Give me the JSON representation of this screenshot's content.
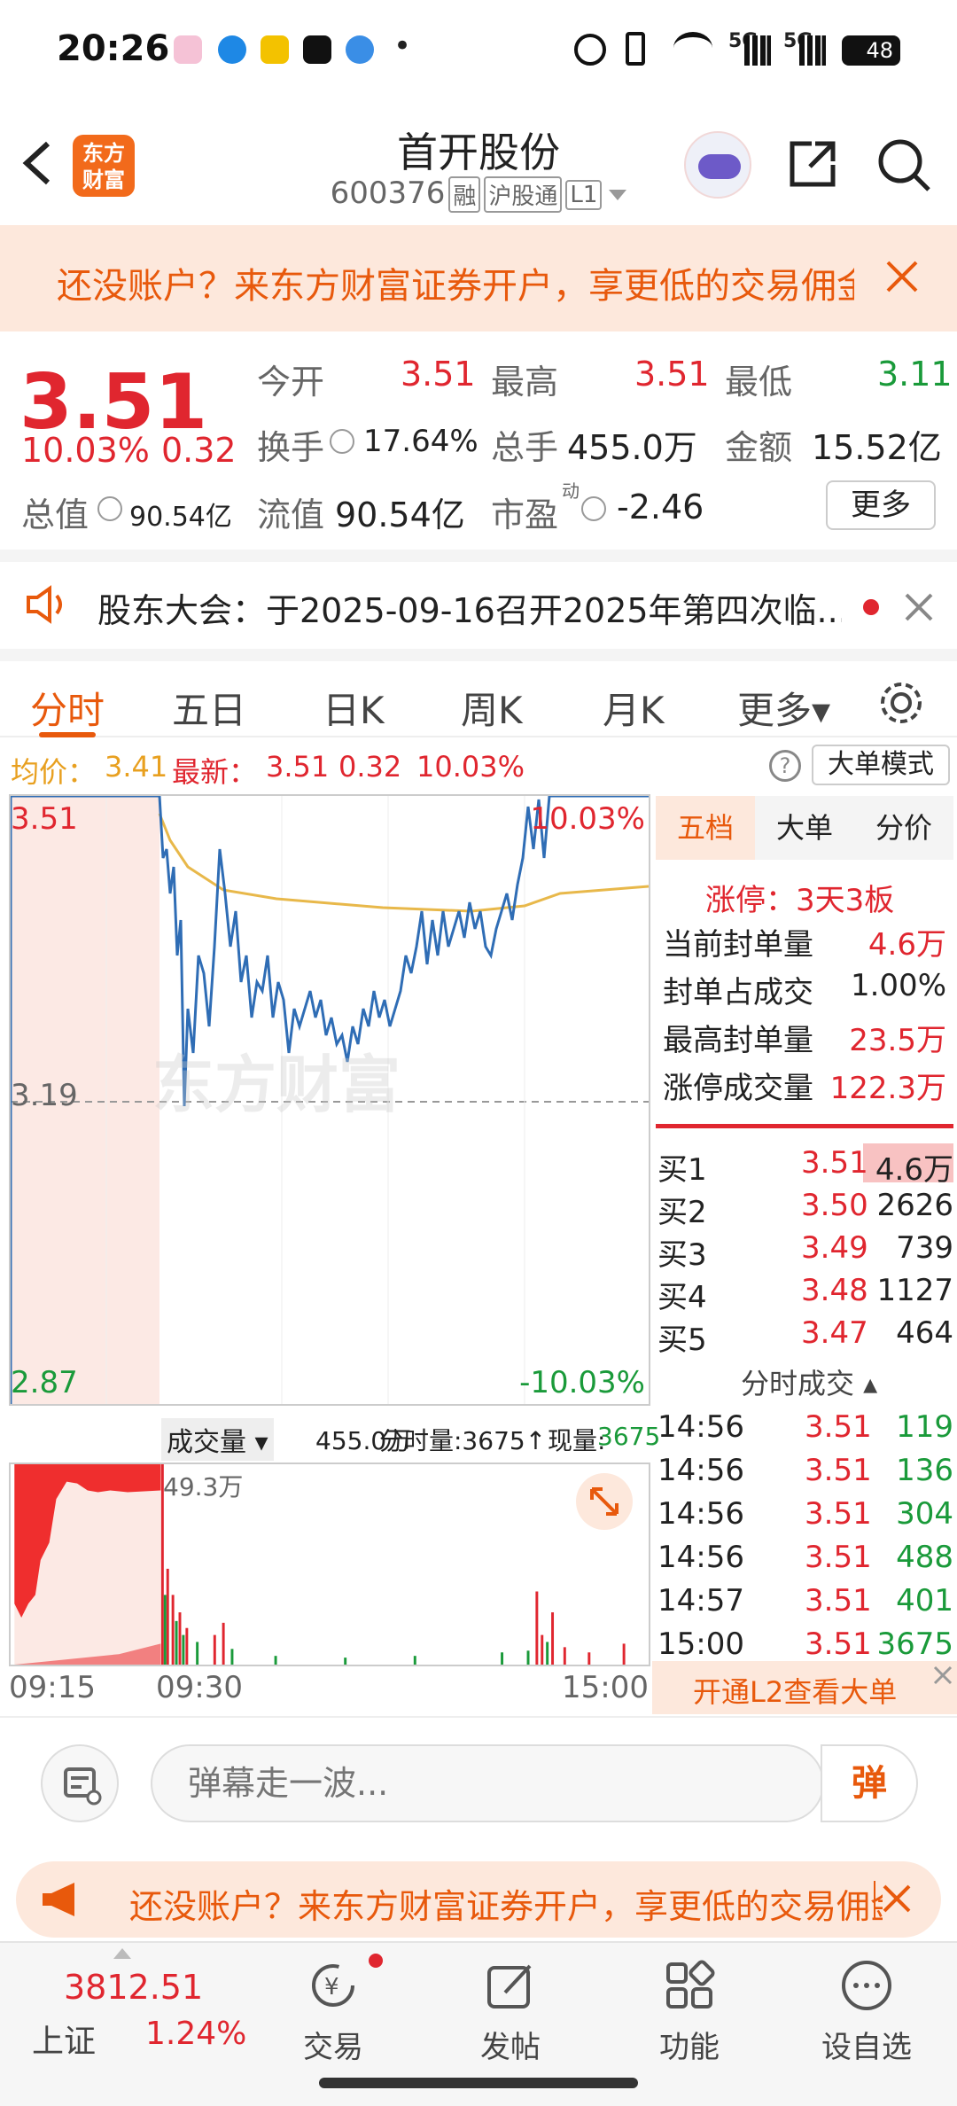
{
  "status_bar": {
    "time": "20:26",
    "dot": "•",
    "network": "5G",
    "network2": "5G",
    "battery": "48"
  },
  "header": {
    "back_label": "<",
    "logo_text": "东方财富",
    "stock_name": "首开股份",
    "stock_code": "600376",
    "tags": [
      "融",
      "沪股通",
      "L1"
    ]
  },
  "banner": {
    "text": "还没账户？来东方财富证券开户，享更低的交易佣金"
  },
  "quote": {
    "price": "3.51",
    "change_pct": "10.03%",
    "change": "0.32",
    "open_label": "今开",
    "open": "3.51",
    "high_label": "最高",
    "high": "3.51",
    "low_label": "最低",
    "low": "3.11",
    "turnover_label": "换手",
    "turnover": "17.64%",
    "volume_label": "总手",
    "volume": "455.0万",
    "amount_label": "金额",
    "amount": "15.52亿",
    "mktcap_label": "总值",
    "mktcap": "90.54亿",
    "float_label": "流值",
    "float": "90.54亿",
    "pe_label": "市盈",
    "pe_sup": "动",
    "pe": "-2.46",
    "more_label": "更多"
  },
  "notice": {
    "text": "股东大会：于2025-09-16召开2025年第四次临..."
  },
  "tabs": [
    "分时",
    "五日",
    "日K",
    "周K",
    "月K",
    "更多▾"
  ],
  "chart_info": {
    "avg_label": "均价：",
    "avg": "3.41",
    "latest_label": "最新：",
    "latest": "3.51",
    "latest_chg": "0.32",
    "latest_pct": "10.03%",
    "mode_label": "大单模式",
    "y_top": "3.51",
    "y_mid": "3.19",
    "y_bottom": "2.87",
    "pct_top": "10.03%",
    "pct_bottom": "-10.03%",
    "watermark": "东方财富"
  },
  "volume": {
    "label": "成交量 ▾",
    "total": "455.0万",
    "period_label": "分时量:3675↑",
    "now_label": "现量:",
    "now": "3675",
    "peak": "49.3万",
    "times": [
      "09:15",
      "09:30",
      "15:00"
    ]
  },
  "panel": {
    "tabs": [
      "五档",
      "大单",
      "分价"
    ],
    "limit_label": "涨停：3天3板",
    "rows": [
      {
        "k": "当前封单量",
        "v": "4.6万"
      },
      {
        "k": "封单占成交",
        "v": "1.00%"
      },
      {
        "k": "最高封单量",
        "v": "23.5万"
      },
      {
        "k": "涨停成交量",
        "v": "122.3万"
      }
    ],
    "book": [
      {
        "k": "买1",
        "p": "3.51",
        "q": "4.6万"
      },
      {
        "k": "买2",
        "p": "3.50",
        "q": "2626"
      },
      {
        "k": "买3",
        "p": "3.49",
        "q": "739"
      },
      {
        "k": "买4",
        "p": "3.48",
        "q": "1127"
      },
      {
        "k": "买5",
        "p": "3.47",
        "q": "464"
      }
    ],
    "ticks_title": "分时成交 ▴",
    "ticks": [
      {
        "t": "14:56",
        "p": "3.51",
        "q": "119"
      },
      {
        "t": "14:56",
        "p": "3.51",
        "q": "136"
      },
      {
        "t": "14:56",
        "p": "3.51",
        "q": "304"
      },
      {
        "t": "14:56",
        "p": "3.51",
        "q": "488"
      },
      {
        "t": "14:57",
        "p": "3.51",
        "q": "401"
      },
      {
        "t": "15:00",
        "p": "3.51",
        "q": "3675"
      }
    ],
    "l2_label": "开通L2查看大单"
  },
  "comment": {
    "placeholder": "弹幕走一波...",
    "send_label": "弹"
  },
  "banner2": {
    "text": "还没账户？来东方财富证券开户，享更低的交易佣金"
  },
  "nav": {
    "index_value": "3812.51",
    "index_name": "上证",
    "index_pct": "1.24%",
    "items": [
      "交易",
      "发帖",
      "功能",
      "设自选"
    ]
  },
  "colors": {
    "up": "#e0262f",
    "down": "#1a9a3a",
    "accent": "#e8590c",
    "line": "#2f6db5",
    "avg": "#e8b84a"
  }
}
